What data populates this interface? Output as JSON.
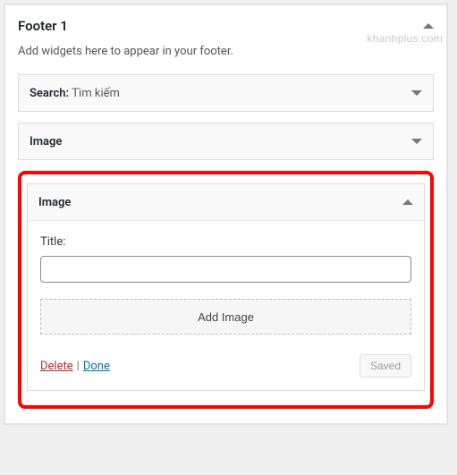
{
  "watermark": "khanhplus.com",
  "panel": {
    "title": "Footer 1",
    "description": "Add widgets here to appear in your footer."
  },
  "widgets": {
    "search": {
      "label": "Search:",
      "instance": "Tìm kiếm"
    },
    "image_collapsed": {
      "label": "Image"
    },
    "image_open": {
      "label": "Image",
      "title_field_label": "Title:",
      "title_value": "",
      "add_image_label": "Add Image",
      "delete_label": "Delete",
      "done_label": "Done",
      "saved_label": "Saved"
    }
  }
}
